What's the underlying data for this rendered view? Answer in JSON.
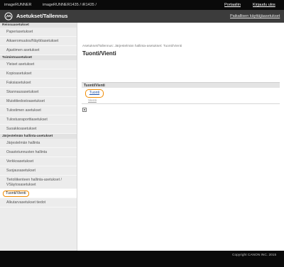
{
  "topbar": {
    "product_name": "imageRUNNER",
    "model": "imageRUNNER1435 / iR1435 /",
    "portal_link": "Portaaliin",
    "logout_link": "Kirjaudu ulos"
  },
  "titlebar": {
    "title": "Asetukset/Tallennus",
    "settings_link": "Paikallisen käyttäjäasetukset"
  },
  "sidebar": {
    "sections": [
      {
        "header": "Reissuasetukset",
        "items": [
          "Paperiasetukset",
          "Aikaeromuutos/Näyttöasetukset",
          "Ajastimen asetukset"
        ]
      },
      {
        "header": "Toimintoasetukset",
        "items": [
          "Yleiset asetukset",
          "Kopioasetukset",
          "Faksiasetukset",
          "Skannausasetukset",
          "Muistitiedostoasetukset",
          "Tulostimen asetukset",
          "Tulostusraporttiasetukset",
          "Suoakkoasetukset"
        ]
      },
      {
        "header": "Järjestelmän hallinta-asetukset",
        "items": [
          "Järjestelmän hallinta",
          "Osastotunnusten hallinta",
          "Verkkoasetukset",
          "Suojausasetukset",
          "Tietoliikenteen hallinta-asetukset / VSäytosasetukset",
          "Tuonti/Vienti",
          "Alkutarvasetukset tiedot"
        ]
      }
    ],
    "active_item": "Tuonti/Vienti"
  },
  "main": {
    "breadcrumb": "Asetukset/Tallennus: Järjestelmän hallinta-asetukset: Tuonti/Vienti",
    "page_title": "Tuonti/Vienti",
    "section_header": "Tuonti/Vienti",
    "import_link": "Tuonti",
    "export_link": "Vienti"
  },
  "footer": {
    "copyright": "Copyright CANON INC. 2015"
  },
  "colors": {
    "highlight": "#f08a00",
    "link": "#1a4fa8",
    "topbar": "#0a0a0a",
    "titlebar": "#3c3c3c",
    "sidebar": "#ececec"
  }
}
